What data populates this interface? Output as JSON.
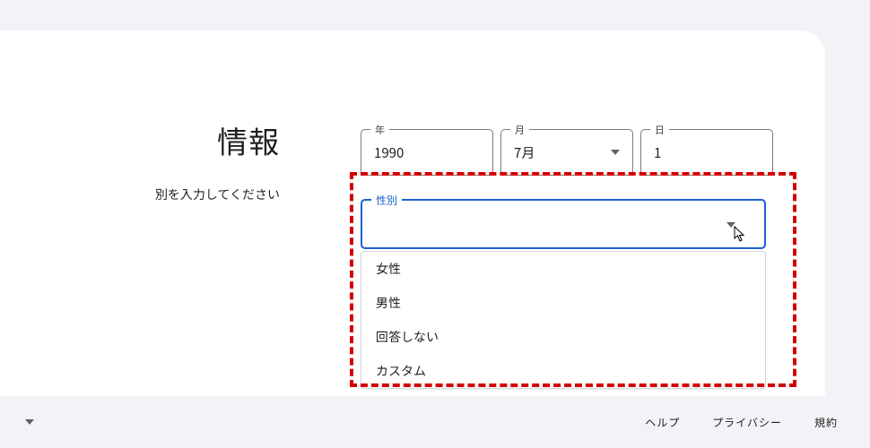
{
  "heading": "情報",
  "subheading": "別を入力してください",
  "fields": {
    "year": {
      "label": "年",
      "value": "1990"
    },
    "month": {
      "label": "月",
      "value": "7月"
    },
    "day": {
      "label": "日",
      "value": "1"
    }
  },
  "gender": {
    "label": "性別",
    "value": "",
    "options": [
      "女性",
      "男性",
      "回答しない",
      "カスタム"
    ]
  },
  "footer": {
    "help": "ヘルプ",
    "privacy": "プライバシー",
    "terms": "規約"
  }
}
